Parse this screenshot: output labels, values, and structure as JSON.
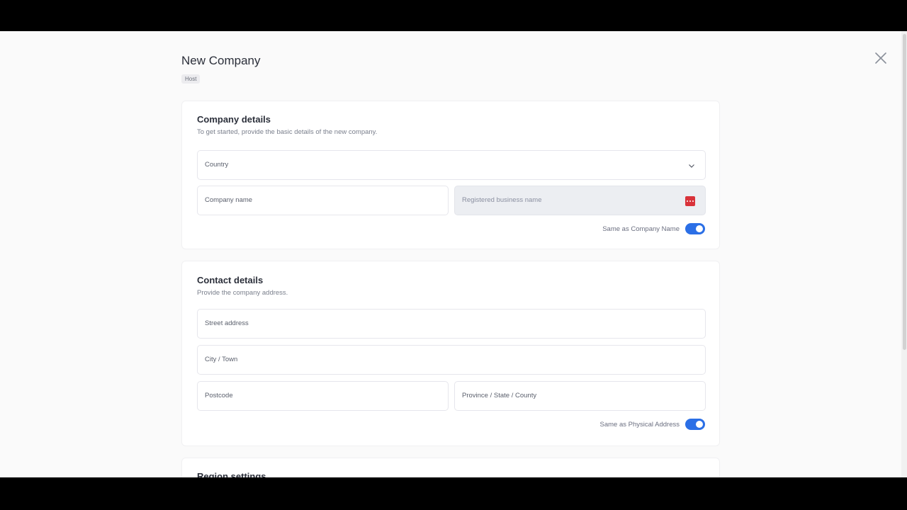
{
  "header": {
    "title": "New Company",
    "tag": "Host"
  },
  "company_details": {
    "title": "Company details",
    "subtitle": "To get started, provide the basic details of the new company.",
    "country_label": "Country",
    "company_name_label": "Company name",
    "registered_name_label": "Registered business name",
    "toggle_label": "Same as Company Name",
    "toggle_on": true
  },
  "contact_details": {
    "title": "Contact details",
    "subtitle": "Provide the company address.",
    "street_label": "Street address",
    "city_label": "City / Town",
    "postcode_label": "Postcode",
    "province_label": "Province / State / County",
    "toggle_label": "Same as Physical Address",
    "toggle_on": true
  },
  "region_settings": {
    "title": "Region settings"
  },
  "colors": {
    "accent": "#2b6fe6",
    "danger": "#d9323a",
    "background": "#fafafa"
  },
  "icons": {
    "close": "close-icon",
    "country_dropdown": "chevron-down-icon",
    "registered_name_action": "more-dots-icon"
  }
}
